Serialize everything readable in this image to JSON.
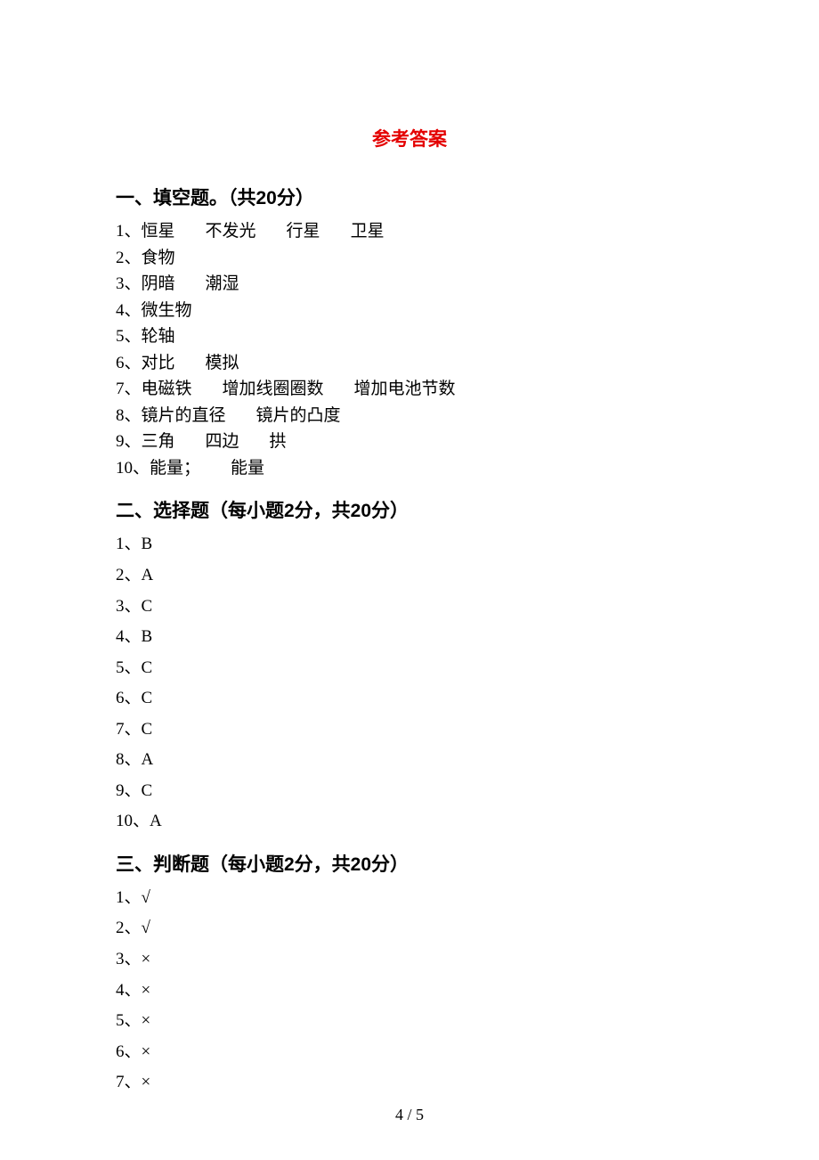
{
  "title": "参考答案",
  "sections": [
    {
      "heading": "一、填空题。（共20分）",
      "lines": [
        {
          "num": "1",
          "parts": [
            "恒星",
            "不发光",
            "行星",
            "卫星"
          ]
        },
        {
          "num": "2",
          "parts": [
            "食物"
          ]
        },
        {
          "num": "3",
          "parts": [
            "阴暗",
            "潮湿"
          ]
        },
        {
          "num": "4",
          "parts": [
            "微生物"
          ]
        },
        {
          "num": "5",
          "parts": [
            "轮轴"
          ]
        },
        {
          "num": "6",
          "parts": [
            "对比",
            "模拟"
          ]
        },
        {
          "num": "7",
          "parts": [
            "电磁铁",
            "增加线圈圈数",
            "增加电池节数"
          ]
        },
        {
          "num": "8",
          "parts": [
            "镜片的直径",
            "镜片的凸度"
          ]
        },
        {
          "num": "9",
          "parts": [
            "三角",
            "四边",
            "拱"
          ]
        },
        {
          "num": "10",
          "parts": [
            "能量；",
            "能量"
          ]
        }
      ]
    },
    {
      "heading": "二、选择题（每小题2分，共20分）",
      "spaced": true,
      "lines": [
        {
          "num": "1",
          "parts": [
            "B"
          ]
        },
        {
          "num": "2",
          "parts": [
            "A"
          ]
        },
        {
          "num": "3",
          "parts": [
            "C"
          ]
        },
        {
          "num": "4",
          "parts": [
            "B"
          ]
        },
        {
          "num": "5",
          "parts": [
            "C"
          ]
        },
        {
          "num": "6",
          "parts": [
            "C"
          ]
        },
        {
          "num": "7",
          "parts": [
            "C"
          ]
        },
        {
          "num": "8",
          "parts": [
            "A"
          ]
        },
        {
          "num": "9",
          "parts": [
            "C"
          ]
        },
        {
          "num": "10",
          "parts": [
            "A"
          ]
        }
      ]
    },
    {
      "heading": "三、判断题（每小题2分，共20分）",
      "spaced": true,
      "lines": [
        {
          "num": "1",
          "parts": [
            "√"
          ]
        },
        {
          "num": "2",
          "parts": [
            "√"
          ]
        },
        {
          "num": "3",
          "parts": [
            "×"
          ]
        },
        {
          "num": "4",
          "parts": [
            "×"
          ]
        },
        {
          "num": "5",
          "parts": [
            "×"
          ]
        },
        {
          "num": "6",
          "parts": [
            "×"
          ]
        },
        {
          "num": "7",
          "parts": [
            "×"
          ]
        }
      ]
    }
  ],
  "pageNumber": "4 / 5"
}
